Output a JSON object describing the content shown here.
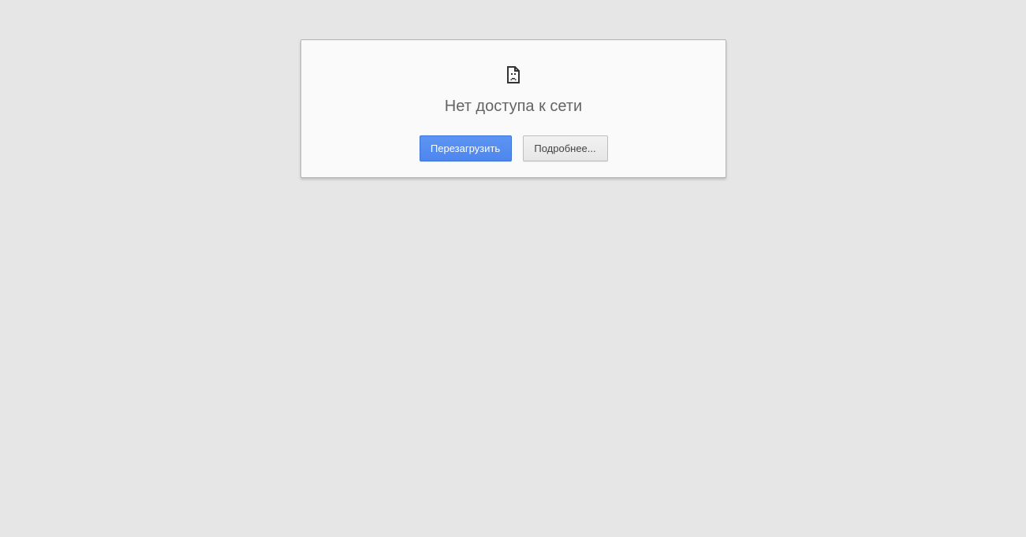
{
  "page": {
    "background_color": "#e6e6e6"
  },
  "error": {
    "icon": "sad-page-icon",
    "title": "Нет доступа к сети"
  },
  "buttons": {
    "reload_label": "Перезагрузить",
    "details_label": "Подробнее...",
    "reload_color": "#4d86ee"
  }
}
